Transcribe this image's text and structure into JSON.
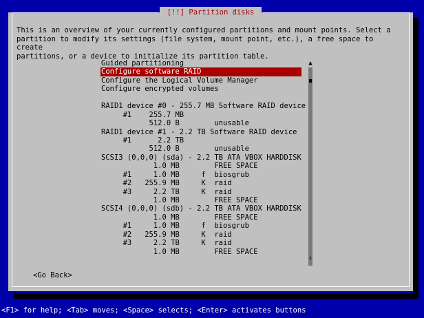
{
  "dialog": {
    "title": "[!!] Partition disks",
    "description": "This is an overview of your currently configured partitions and mount points. Select a\npartition to modify its settings (file system, mount point, etc.), a free space to create\npartitions, or a device to initialize its partition table."
  },
  "list": {
    "items": [
      "Guided partitioning",
      "Configure software RAID",
      "Configure the Logical Volume Manager",
      "Configure encrypted volumes",
      "",
      "RAID1 device #0 - 255.7 MB Software RAID device",
      "     #1    255.7 MB",
      "           512.0 B        unusable",
      "RAID1 device #1 - 2.2 TB Software RAID device",
      "     #1      2.2 TB",
      "           512.0 B        unusable",
      "SCSI3 (0,0,0) (sda) - 2.2 TB ATA VBOX HARDDISK",
      "            1.0 MB        FREE SPACE",
      "     #1     1.0 MB     f  biosgrub",
      "     #2   255.9 MB     K  raid",
      "     #3     2.2 TB     K  raid",
      "            1.0 MB        FREE SPACE",
      "SCSI4 (0,0,0) (sdb) - 2.2 TB ATA VBOX HARDDISK",
      "            1.0 MB        FREE SPACE",
      "     #1     1.0 MB     f  biosgrub",
      "     #2   255.9 MB     K  raid",
      "     #3     2.2 TB     K  raid",
      "            1.0 MB        FREE SPACE"
    ],
    "selected_label": "Configure software RAID"
  },
  "buttons": {
    "go_back": "<Go Back>"
  },
  "help_bar": "<F1> for help; <Tab> moves; <Space> selects; <Enter> activates buttons",
  "colors": {
    "background": "#0000aa",
    "dialog": "#c0c0c0",
    "title_text": "#aa0000",
    "selection": "#aa0000"
  }
}
